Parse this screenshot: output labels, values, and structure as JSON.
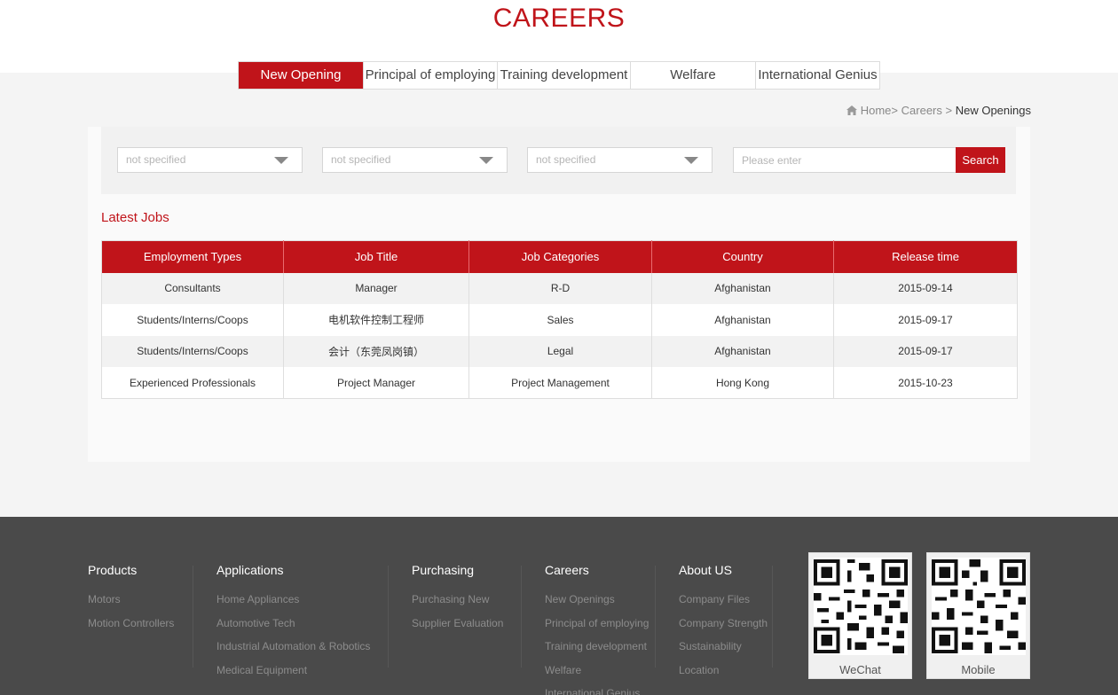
{
  "header": {
    "title": "CAREERS"
  },
  "tabs": [
    {
      "label": "New Opening",
      "active": true
    },
    {
      "label": "Principal of employing",
      "active": false
    },
    {
      "label": "Training development",
      "active": false
    },
    {
      "label": "Welfare",
      "active": false
    },
    {
      "label": "International Genius",
      "active": false
    }
  ],
  "breadcrumb": {
    "home": "Home>",
    "section": "Careers >",
    "current": "New Openings"
  },
  "filters": {
    "select1": "not specified",
    "select2": "not specified",
    "select3": "not specified",
    "search_placeholder": "Please enter",
    "search_button": "Search"
  },
  "jobs": {
    "title": "Latest Jobs",
    "columns": [
      "Employment Types",
      "Job Title",
      "Job Categories",
      "Country",
      "Release time"
    ],
    "rows": [
      [
        "Consultants",
        "Manager",
        "R-D",
        "Afghanistan",
        "2015-09-14"
      ],
      [
        "Students/Interns/Coops",
        "电机软件控制工程师",
        "Sales",
        "Afghanistan",
        "2015-09-17"
      ],
      [
        "Students/Interns/Coops",
        "会计（东莞凤岗镇）",
        "Legal",
        "Afghanistan",
        "2015-09-17"
      ],
      [
        "Experienced Professionals",
        "Project Manager",
        "Project Management",
        "Hong Kong",
        "2015-10-23"
      ]
    ]
  },
  "footer": {
    "products": {
      "title": "Products",
      "links": [
        "Motors",
        "Motion Controllers"
      ]
    },
    "applications": {
      "title": "Applications",
      "links": [
        "Home Appliances",
        "Automotive Tech",
        "Industrial Automation & Robotics",
        "Medical Equipment"
      ]
    },
    "purchasing": {
      "title": "Purchasing",
      "links": [
        "Purchasing New",
        "Supplier Evaluation"
      ]
    },
    "careers": {
      "title": "Careers",
      "links": [
        "New Openings",
        "Principal of employing",
        "Training development",
        "Welfare",
        "International Genius"
      ]
    },
    "about": {
      "title": "About US",
      "links": [
        "Company Files",
        "Company Strength",
        "Sustainability",
        "Location"
      ]
    },
    "qr": {
      "wechat": "WeChat",
      "mobile": "Mobile"
    }
  },
  "colors": {
    "brand": "#c0141a",
    "footer_bg": "#4a4a4a"
  }
}
